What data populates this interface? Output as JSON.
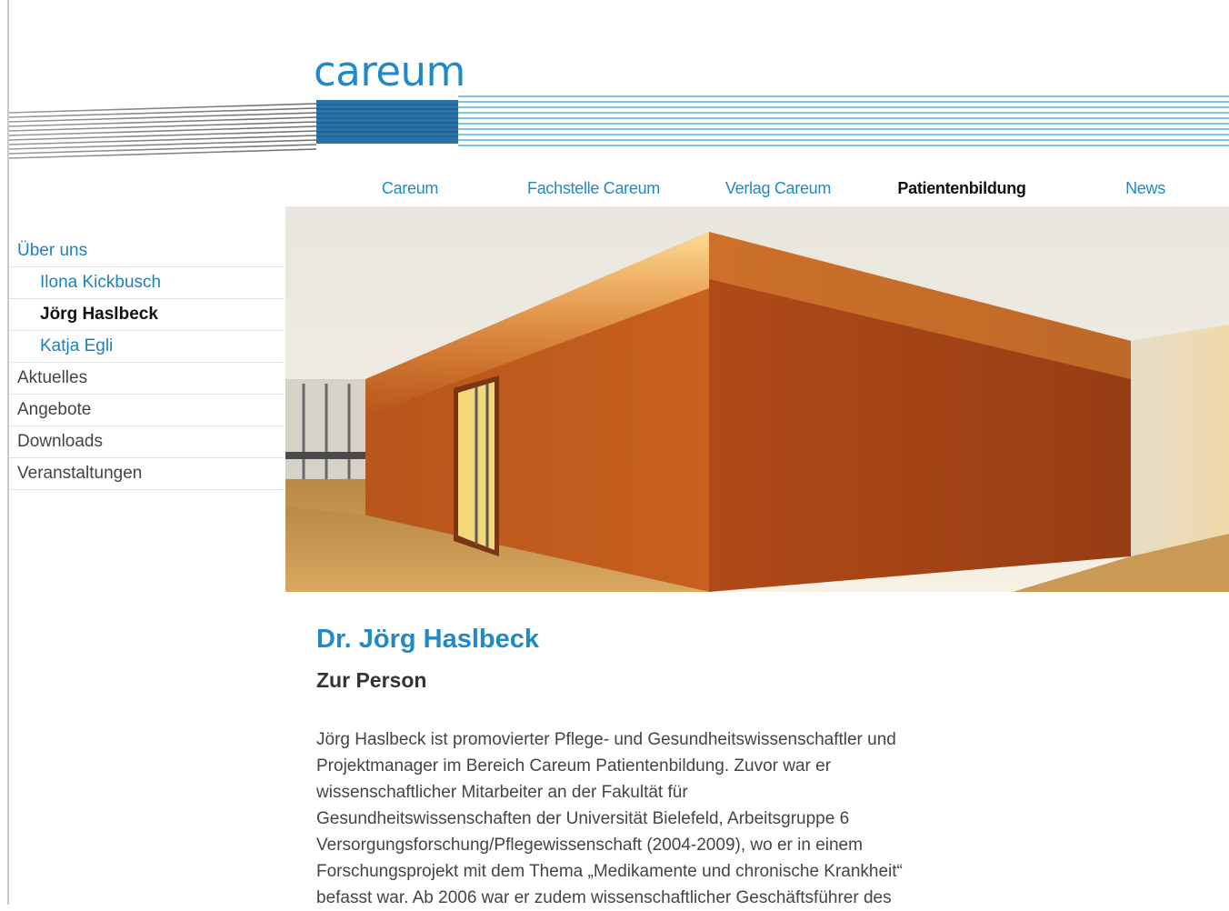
{
  "brand": {
    "logo_text": "careum",
    "colors": {
      "primary": "#1f8ac8",
      "stripe_light": "#7cc4ea",
      "stripe_grey": "#8c8c8c"
    }
  },
  "top_nav": [
    {
      "label": "Careum",
      "active": false
    },
    {
      "label": "Fachstelle Careum",
      "active": false
    },
    {
      "label": "Verlag Careum",
      "active": false
    },
    {
      "label": "Patientenbildung",
      "active": true
    },
    {
      "label": "News",
      "active": false
    }
  ],
  "side_nav": [
    {
      "label": "Über uns",
      "level": 1,
      "active": false
    },
    {
      "label": "Ilona Kickbusch",
      "level": 2,
      "active": false
    },
    {
      "label": "Jörg Haslbeck",
      "level": 2,
      "active": true
    },
    {
      "label": "Katja Egli",
      "level": 2,
      "active": false
    },
    {
      "label": "Aktuelles",
      "level": 1,
      "active": false
    },
    {
      "label": "Angebote",
      "level": 1,
      "active": false
    },
    {
      "label": "Downloads",
      "level": 1,
      "active": false
    },
    {
      "label": "Veranstaltungen",
      "level": 1,
      "active": false
    }
  ],
  "content": {
    "title": "Dr. Jörg Haslbeck",
    "section_heading": "Zur Person",
    "bio_lines": [
      "Jörg Haslbeck ist promovierter Pflege- und Gesundheitswissenschaftler und",
      "Projektmanager im Bereich Careum Patientenbildung. Zuvor war er",
      "wissenschaftlicher Mitarbeiter an der Fakultät für",
      "Gesundheitswissenschaften der Universität Bielefeld, Arbeitsgruppe 6",
      "Versorgungsforschung/Pflegewissenschaft (2004-2009), wo er in einem",
      "Forschungsprojekt mit dem Thema „Medikamente und chronische Krankheit“",
      "befasst war. Ab 2006 war er zudem wissenschaftlicher Geschäftsführer des"
    ]
  }
}
